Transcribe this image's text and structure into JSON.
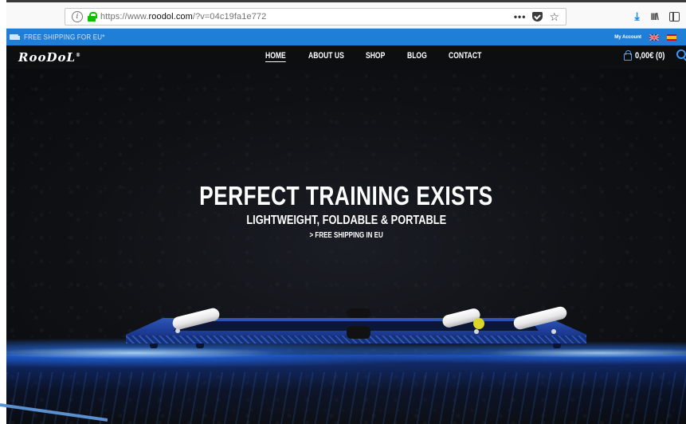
{
  "browser": {
    "url_prefix": "https://www.",
    "url_domain": "roodol.com",
    "url_path": "/?v=04c19fa1e772",
    "info_glyph": "i",
    "more_glyph": "•••",
    "star_glyph": "☆",
    "download_glyph": "⤓",
    "library_glyph": "III\\"
  },
  "promo": {
    "text": "FREE SHIPPING FOR EU*",
    "account": "My Account",
    "bar_color": "#1f7fd6"
  },
  "navbar": {
    "logo": "RooDoL",
    "logo_mark": "®",
    "items": [
      {
        "label": "HOME",
        "active": true
      },
      {
        "label": "ABOUT US",
        "active": false
      },
      {
        "label": "SHOP",
        "active": false
      },
      {
        "label": "BLOG",
        "active": false
      },
      {
        "label": "CONTACT",
        "active": false
      }
    ],
    "cart": "0,00€ (0)"
  },
  "hero": {
    "title": "PERFECT TRAINING EXISTS",
    "subtitle": "LIGHTWEIGHT, FOLDABLE & PORTABLE",
    "shipping": "> FREE SHIPPING IN EU"
  },
  "icons": [
    "info-icon",
    "lock-icon",
    "more-actions-icon",
    "pocket-icon",
    "bookmark-star-icon",
    "download-icon",
    "library-icon",
    "sidebar-icon",
    "truck-icon",
    "uk-flag-icon",
    "spain-flag-icon",
    "cart-bag-icon",
    "search-icon"
  ]
}
